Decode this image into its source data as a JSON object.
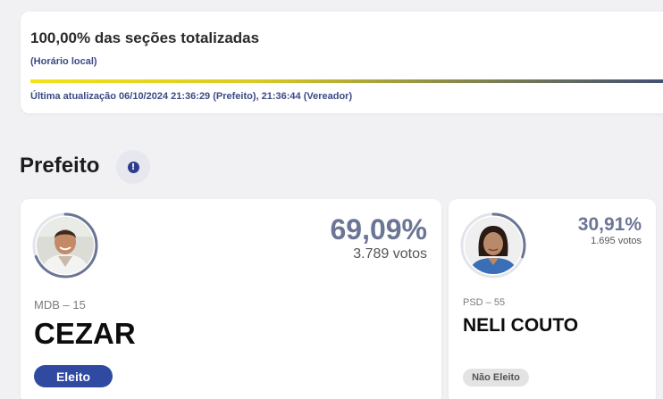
{
  "status": {
    "title": "100,00% das seções totalizadas",
    "subtitle": "(Horário local)",
    "progress_percent": 100,
    "last_update": "Última atualização 06/10/2024 21:36:29 (Prefeito), 21:36:44 (Vereador)"
  },
  "section": {
    "title": "Prefeito",
    "info_icon": "exclamation-info-icon"
  },
  "candidates": [
    {
      "name": "CEZAR",
      "party": "MDB – 15",
      "percent": "69,09%",
      "votes": "3.789 votos",
      "status": "Eleito",
      "vote_share": 69.09
    },
    {
      "name": "NELI COUTO",
      "party": "PSD – 55",
      "percent": "30,91%",
      "votes": "1.695 votos",
      "status": "Não Eleito",
      "vote_share": 30.91
    }
  ],
  "colors": {
    "accent": "#2f4aa0",
    "ring": "#6b7695",
    "status_text": "#3b4a86"
  }
}
